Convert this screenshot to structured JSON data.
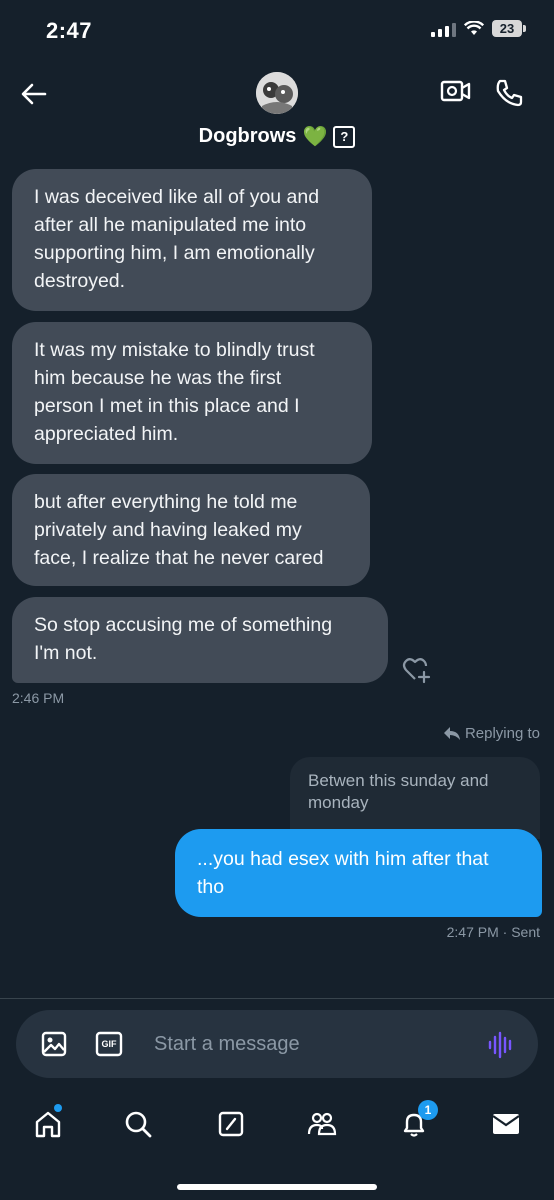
{
  "status_bar": {
    "time": "2:47",
    "battery": "23"
  },
  "header": {
    "name": "Dogbrows",
    "verified_emoji": "💚",
    "unknown_glyph": "?"
  },
  "messages": [
    {
      "side": "received",
      "text": "I was deceived like all of you and\nafter all he manipulated me into\nsupporting him, I am emotionally\ndestroyed."
    },
    {
      "side": "received",
      "text": "It was my mistake to blindly trust\nhim because he was the first\nperson I met in this place and I\nappreciated him."
    },
    {
      "side": "received",
      "text": "but after everything he told me\nprivately and having leaked my\nface, I realize that he never cared"
    },
    {
      "side": "received",
      "text": "So stop accusing me of something\nI'm not."
    }
  ],
  "received_timestamp": "2:46 PM",
  "reply": {
    "label": "Replying to",
    "quoted_text": "Betwen this sunday and\nmonday"
  },
  "sent_message": {
    "text": "...you had esex with him after that tho",
    "timestamp": "2:47 PM · Sent"
  },
  "composer": {
    "placeholder": "Start a message",
    "gif_label": "GIF"
  },
  "tabbar": {
    "notifications_count": "1"
  },
  "colors": {
    "background": "#15202b",
    "received_bubble": "#424b57",
    "sent_bubble": "#1d9bf0",
    "accent": "#1d9bf0",
    "muted_text": "#8b98a5"
  },
  "icons": [
    "back-arrow-icon",
    "video-call-icon",
    "phone-icon",
    "add-reaction-icon",
    "reply-arrow-icon",
    "image-icon",
    "gif-icon",
    "voice-wave-icon",
    "home-icon",
    "search-icon",
    "compose-icon",
    "communities-icon",
    "bell-icon",
    "mail-icon"
  ]
}
